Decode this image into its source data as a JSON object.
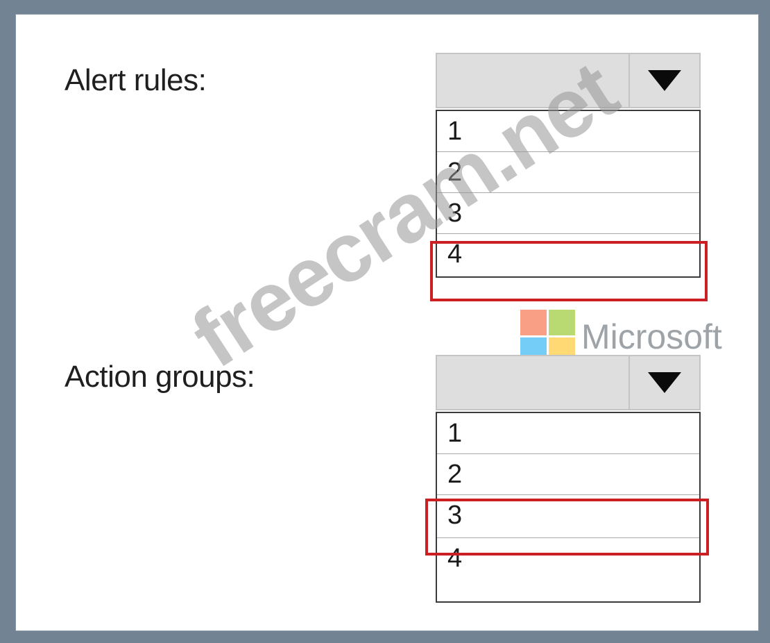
{
  "alert_rules": {
    "label": "Alert rules:",
    "selected_value": "",
    "options": [
      "1",
      "2",
      "3",
      "4"
    ],
    "highlighted_option": "4"
  },
  "action_groups": {
    "label": "Action groups:",
    "selected_value": "",
    "options": [
      "1",
      "2",
      "3",
      "4"
    ],
    "highlighted_option": "3"
  },
  "logo": {
    "text": "Microsoft",
    "colors": [
      "#f25022",
      "#7fba00",
      "#00a4ef",
      "#ffb900"
    ]
  },
  "watermark": {
    "text": "freecram.net"
  },
  "colors": {
    "highlight": "#cc1f24",
    "frame": "#728494"
  }
}
